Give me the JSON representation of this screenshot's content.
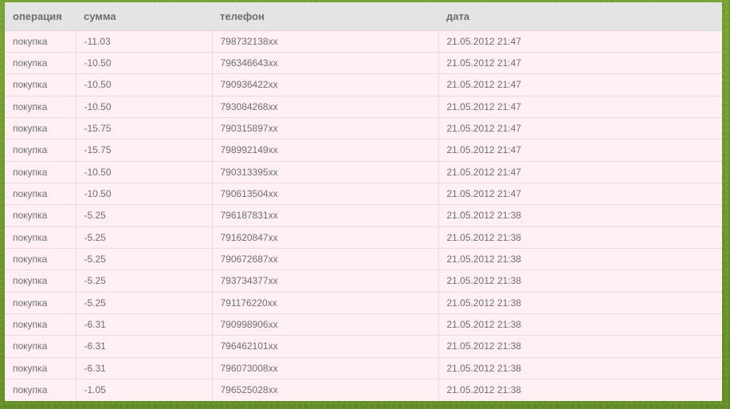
{
  "columns": [
    "операция",
    "сумма",
    "телефон",
    "дата"
  ],
  "rows": [
    [
      "покупка",
      "-11.03",
      "798732138xx",
      "21.05.2012 21:47"
    ],
    [
      "покупка",
      "-10.50",
      "796346643xx",
      "21.05.2012 21:47"
    ],
    [
      "покупка",
      "-10.50",
      "790936422xx",
      "21.05.2012 21:47"
    ],
    [
      "покупка",
      "-10.50",
      "793084268xx",
      "21.05.2012 21:47"
    ],
    [
      "покупка",
      "-15.75",
      "790315897xx",
      "21.05.2012 21:47"
    ],
    [
      "покупка",
      "-15.75",
      "798992149xx",
      "21.05.2012 21:47"
    ],
    [
      "покупка",
      "-10.50",
      "790313395xx",
      "21.05.2012 21:47"
    ],
    [
      "покупка",
      "-10.50",
      "790613504xx",
      "21.05.2012 21:47"
    ],
    [
      "покупка",
      "-5.25",
      "796187831xx",
      "21.05.2012 21:38"
    ],
    [
      "покупка",
      "-5.25",
      "791620847xx",
      "21.05.2012 21:38"
    ],
    [
      "покупка",
      "-5.25",
      "790672687xx",
      "21.05.2012 21:38"
    ],
    [
      "покупка",
      "-5.25",
      "793734377xx",
      "21.05.2012 21:38"
    ],
    [
      "покупка",
      "-5.25",
      "791176220xx",
      "21.05.2012 21:38"
    ],
    [
      "покупка",
      "-6.31",
      "790998906xx",
      "21.05.2012 21:38"
    ],
    [
      "покупка",
      "-6.31",
      "796462101xx",
      "21.05.2012 21:38"
    ],
    [
      "покупка",
      "-6.31",
      "796073008xx",
      "21.05.2012 21:38"
    ],
    [
      "покупка",
      "-1.05",
      "796525028xx",
      "21.05.2012 21:38"
    ]
  ]
}
